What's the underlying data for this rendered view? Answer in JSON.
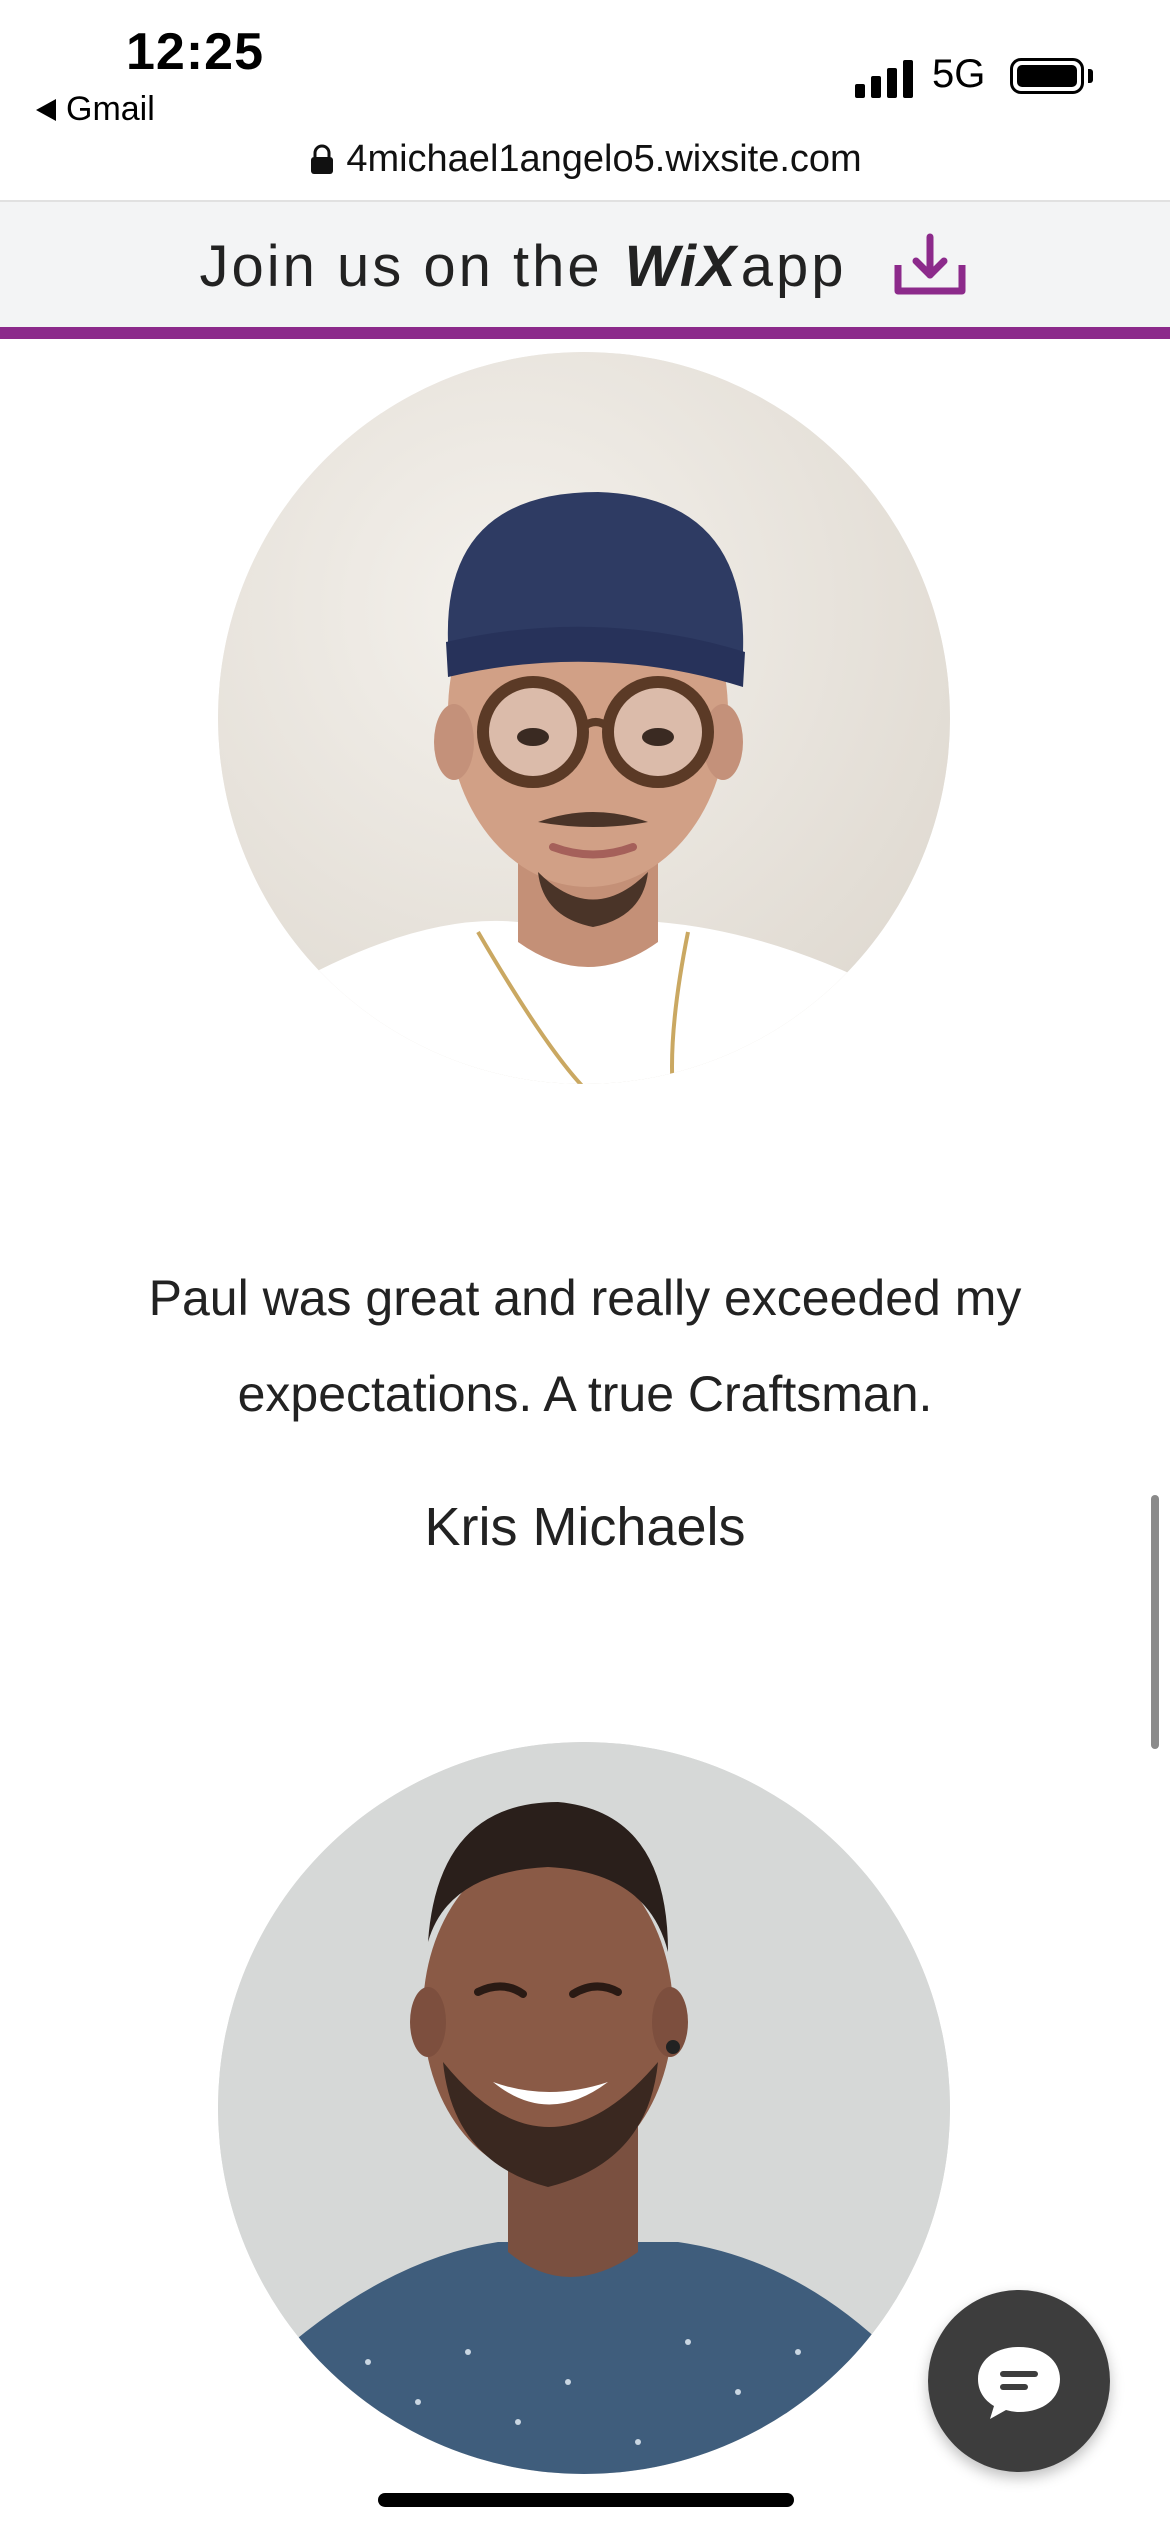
{
  "status_bar": {
    "time": "12:25",
    "back_app": "Gmail",
    "network": "5G",
    "icons": [
      "signal-icon",
      "battery-icon",
      "back-arrow-icon"
    ]
  },
  "browser": {
    "url": "4michael1angelo5.wixsite.com",
    "lock_icon": "lock-icon"
  },
  "banner": {
    "join_text": "Join us on the",
    "brand": "WiX",
    "app_text": "app",
    "icon": "download-icon",
    "accent_color": "#8c2a8b"
  },
  "testimonial": {
    "quote": "Paul was great and really exceeded my expectations. A true Craftsman.",
    "author": "Kris Michaels"
  },
  "chat": {
    "icon": "chat-bubble-icon"
  }
}
